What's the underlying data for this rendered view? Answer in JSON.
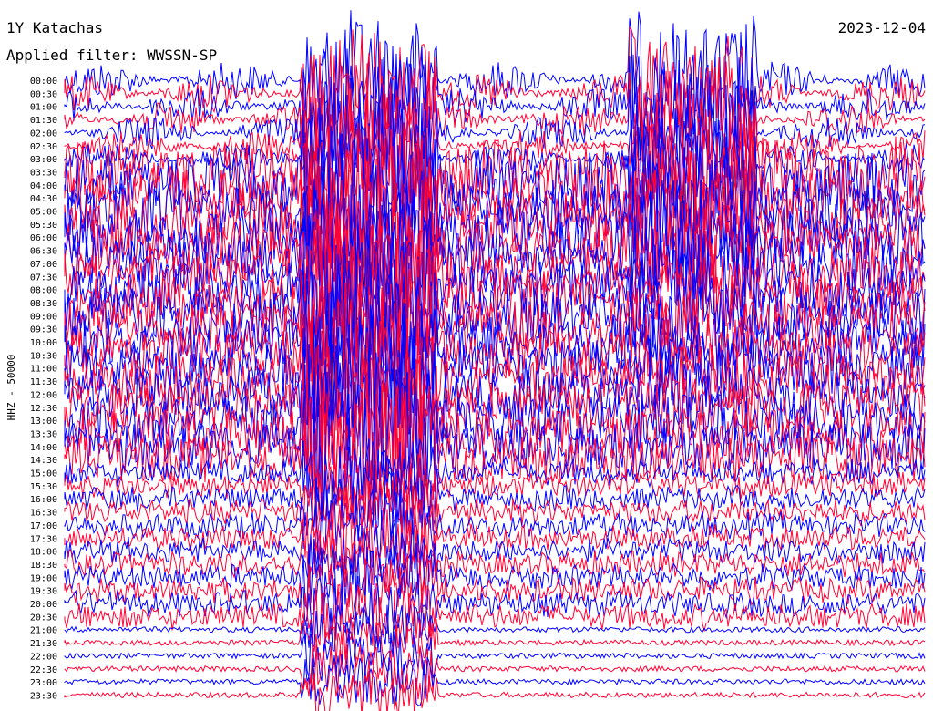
{
  "header": {
    "station": "1Y Katachas",
    "date": "2023-12-04",
    "filter_text": "Applied filter: WWSSN-SP"
  },
  "chart_data": {
    "type": "line",
    "title": "1Y Katachas",
    "date": "2023-12-04",
    "filter": "WWSSN-SP",
    "ylabel": "HHZ - 50000",
    "row_labels": [
      "00:00",
      "00:30",
      "01:00",
      "01:30",
      "02:00",
      "02:30",
      "03:00",
      "03:30",
      "04:00",
      "04:30",
      "05:00",
      "05:30",
      "06:00",
      "06:30",
      "07:00",
      "07:30",
      "08:00",
      "08:30",
      "09:00",
      "09:30",
      "10:00",
      "10:30",
      "11:00",
      "11:30",
      "12:00",
      "12:30",
      "13:00",
      "13:30",
      "14:00",
      "14:30",
      "15:00",
      "15:30",
      "16:00",
      "16:30",
      "17:00",
      "17:30",
      "18:00",
      "18:30",
      "19:00",
      "19:30",
      "20:00",
      "20:30",
      "21:00",
      "21:30",
      "22:00",
      "22:30",
      "23:00",
      "23:30"
    ],
    "row_colors": [
      "#0000ff",
      "#ff0033"
    ],
    "grid": false,
    "x_minutes_per_row": 30
  }
}
